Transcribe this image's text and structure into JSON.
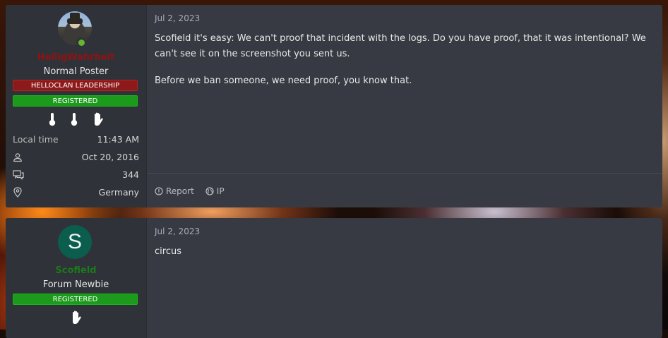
{
  "posts": [
    {
      "user": {
        "name": "HeiligWahrheit",
        "title": "Normal Poster",
        "banners": [
          "HELLOCLAN LEADERSHIP",
          "REGISTERED"
        ],
        "online": true,
        "name_color": "#8d1414",
        "stats": {
          "local_time_label": "Local time",
          "local_time": "11:43 AM",
          "joined": "Oct 20, 2016",
          "messages": "344",
          "location": "Germany"
        },
        "trophy_icons": [
          "thermometer-icon",
          "thermometer-icon",
          "raised-hand-icon"
        ]
      },
      "date": "Jul 2, 2023",
      "message": [
        "Scofield it's easy: We can't proof that incident with the logs. Do you have proof, that it was intentional? We can't see it on the screenshot you sent us.",
        "Before we ban someone, we need proof, you know that."
      ],
      "actions": [
        "Report",
        "IP"
      ]
    },
    {
      "user": {
        "name": "Scofield",
        "avatar_letter": "S",
        "title": "Forum Newbie",
        "banners": [
          "REGISTERED"
        ],
        "name_color": "#1b7a1b",
        "trophy_icons": [
          "raised-hand-icon"
        ]
      },
      "date": "Jul 2, 2023",
      "message": [
        "circus"
      ]
    }
  ]
}
